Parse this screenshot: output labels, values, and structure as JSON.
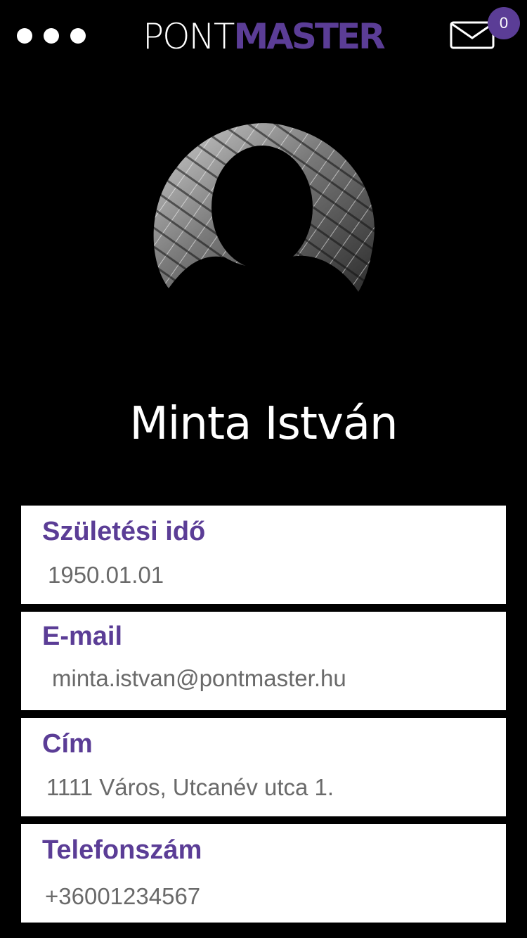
{
  "header": {
    "menu_icon": "more-horizontal-icon",
    "logo_part1": "PONT",
    "logo_part2": "MASTER",
    "mail_icon": "envelope-icon",
    "unread_count": "0"
  },
  "profile": {
    "avatar_icon": "user-silhouette-icon",
    "name": "Minta István"
  },
  "fields": [
    {
      "label": "Születési idő",
      "value": "1950.01.01"
    },
    {
      "label": "E-mail",
      "value": "minta.istvan@pontmaster.hu"
    },
    {
      "label": "Cím",
      "value": "1111 Város, Utcanév utca 1."
    },
    {
      "label": "Telefonszám",
      "value": "+36001234567"
    }
  ],
  "colors": {
    "background": "#000000",
    "accent": "#5b3d96",
    "card": "#ffffff",
    "value_text": "#6a6a6a"
  }
}
